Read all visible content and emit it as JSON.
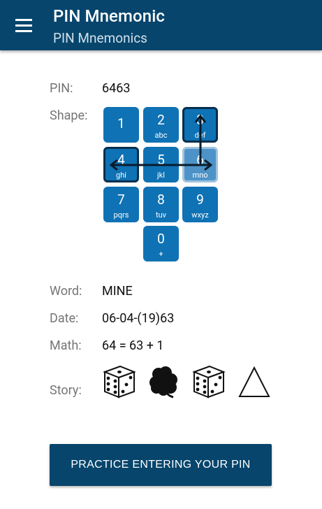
{
  "appbar": {
    "title": "PIN Mnemonic",
    "subtitle": "PIN Mnemonics",
    "menu_icon": "hamburger-menu-icon"
  },
  "pin": {
    "label": "PIN:",
    "value": "6463"
  },
  "shape": {
    "label": "Shape:",
    "keys": [
      {
        "num": "1",
        "letters": ""
      },
      {
        "num": "2",
        "letters": "abc"
      },
      {
        "num": "3",
        "letters": "def"
      },
      {
        "num": "4",
        "letters": "ghi"
      },
      {
        "num": "5",
        "letters": "jkl"
      },
      {
        "num": "6",
        "letters": "mno"
      },
      {
        "num": "7",
        "letters": "pqrs"
      },
      {
        "num": "8",
        "letters": "tuv"
      },
      {
        "num": "9",
        "letters": "wxyz"
      },
      {
        "num": "0",
        "letters": "+"
      }
    ]
  },
  "word": {
    "label": "Word:",
    "value": "MINE"
  },
  "date": {
    "label": "Date:",
    "value": "06-04-(19)63"
  },
  "math": {
    "label": "Math:",
    "value": "64 = 63 + 1"
  },
  "story": {
    "label": "Story:",
    "icons": [
      "dice-six-icon",
      "clover-icon",
      "dice-six-icon",
      "triangle-icon"
    ]
  },
  "practice_button": {
    "label": "PRACTICE ENTERING YOUR PIN"
  },
  "colors": {
    "appbar": "#07456c",
    "key": "#0f72b4",
    "key_selected_border": "#052f4e",
    "key_light": "#4d93c7"
  }
}
